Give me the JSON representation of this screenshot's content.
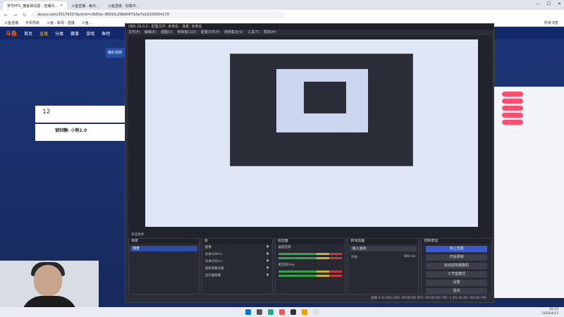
{
  "browser": {
    "tabs": [
      "罗杰PFG_魔鱼驿站图 - 直播间...",
      "斗鱼直播 · 每日...",
      "斗鱼直播 - 加载中..."
    ],
    "url": "douyu.com/2517933?dyshid=c9d5ac-36093c29b6f4f7b5e7a19200004170",
    "bookmarks": [
      "斗鱼直播",
      "手机导航",
      "斗鱼 - 新闻 · 直播",
      "斗鱼...",
      "所有书签"
    ]
  },
  "site": {
    "logo": "斗鱼",
    "nav": [
      "首页",
      "直播",
      "分类",
      "赛事",
      "游戏",
      "鱼吧"
    ],
    "banner": "精彩视频",
    "card_number": "12",
    "host_name": "钢剑糖: 小熊2.0"
  },
  "obs": {
    "title": "OBS 29.0.0 - 配置文件: 未命名 - 场景: 未命名",
    "menu": [
      "文件(F)",
      "编辑(E)",
      "视图(V)",
      "停靠窗口(D)",
      "配置文件(P)",
      "场景集合(S)",
      "工具(T)",
      "帮助(H)"
    ],
    "source_bar": "未选择源",
    "docks": {
      "scenes": "场景",
      "scene_item": "场景",
      "sources": "源",
      "source_items": [
        "图像",
        "文本(GDI+)",
        "文本(GDI+)",
        "视频采集设备",
        "显示器采集"
      ],
      "mixer": "混音器",
      "mixer_items": [
        "桌面音频",
        "麦克风/Aux"
      ],
      "transitions": "转场动画",
      "transition_value": "淡入淡出",
      "duration_label": "时长",
      "duration_value": "300 ms",
      "controls": "控制按钮",
      "buttons": [
        "停止直播",
        "开始录制",
        "启动虚拟摄像机",
        "工作室模式",
        "设置",
        "退出"
      ]
    },
    "status": "丢帧 0 (0.0%)   LIVE: 00:00:00   REC: 00:00:00   CPU: 1.3%   60.00 / 60.00 FPS"
  },
  "clock": {
    "time": "20:12",
    "date": "2024/4/12"
  }
}
